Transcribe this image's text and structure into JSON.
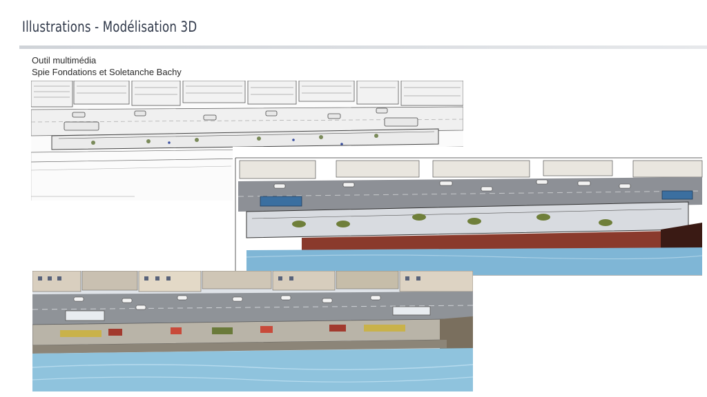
{
  "header": {
    "title": "Illustrations - Modélisation 3D"
  },
  "caption": {
    "line1": "Outil multimédia",
    "line2": "Spie Fondations et Soletanche Bachy"
  },
  "illustrations": [
    {
      "name": "sketch-top-left",
      "style": "pencil-sketch"
    },
    {
      "name": "sketch-right",
      "style": "colored-sketch"
    },
    {
      "name": "render-bottom",
      "style": "3d-render"
    }
  ],
  "colors": {
    "title": "#2e3748",
    "water": "#7fb6d6",
    "dike": "#8a3a2c"
  }
}
